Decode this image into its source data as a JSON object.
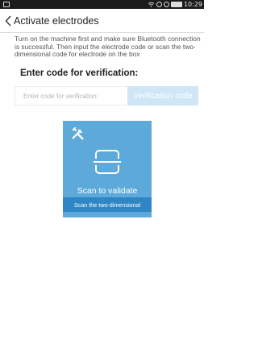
{
  "status_bar": {
    "time": "10:29"
  },
  "header": {
    "title": "Activate electrodes"
  },
  "instructions": "Turn on the machine first and make sure Bluetooth connection is successful. Then input the electrode code or scan the two-dimensional code for electrode on the box",
  "verification": {
    "title": "Enter code for verification:",
    "input_placeholder": "Enter code for verification:",
    "input_value": "",
    "button_label": "Verification code"
  },
  "scan_card": {
    "label": "Scan to validate",
    "strip_label": "Scan the two-dimensional"
  },
  "colors": {
    "card_bg": "#5da9d9",
    "card_strip": "#2f86c4",
    "verify_button": "#cfe6f6",
    "status_bar": "#1b1b1b"
  }
}
